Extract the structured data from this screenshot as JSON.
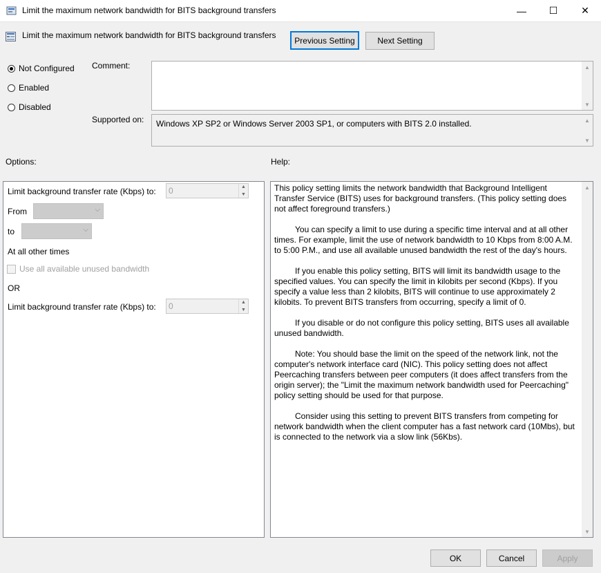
{
  "window": {
    "title": "Limit the maximum network bandwidth for BITS background transfers",
    "controls": {
      "minimize": "—",
      "maximize": "☐",
      "close": "✕"
    }
  },
  "header": {
    "title": "Limit the maximum network bandwidth for BITS background transfers",
    "previous_label": "Previous Setting",
    "next_label": "Next Setting"
  },
  "state": {
    "options": [
      {
        "label": "Not Configured",
        "selected": true
      },
      {
        "label": "Enabled",
        "selected": false
      },
      {
        "label": "Disabled",
        "selected": false
      }
    ]
  },
  "comment": {
    "label": "Comment:",
    "value": ""
  },
  "supported": {
    "label": "Supported on:",
    "value": "Windows XP SP2 or Windows Server 2003 SP1, or computers with BITS 2.0 installed."
  },
  "options_panel": {
    "heading": "Options:",
    "rate_label_1": "Limit background transfer rate (Kbps) to:",
    "rate_value_1": "0",
    "from_label": "From",
    "to_label": "to",
    "other_times_label": "At all other times",
    "use_all_label": "Use all available unused bandwidth",
    "or_label": "OR",
    "rate_label_2": "Limit background transfer rate (Kbps) to:",
    "rate_value_2": "0"
  },
  "help_panel": {
    "heading": "Help:",
    "paragraphs": [
      "This policy setting limits the network bandwidth that Background Intelligent Transfer Service (BITS) uses for background transfers. (This policy setting does not affect foreground transfers.)",
      "You can specify a limit to use during a specific time interval and at all other times. For example, limit the use of network bandwidth to 10 Kbps from 8:00 A.M. to 5:00 P.M., and use all available unused bandwidth the rest of the day's hours.",
      "If you enable this policy setting, BITS will limit its bandwidth usage to the specified values. You can specify the limit in kilobits per second (Kbps). If you specify a value less than 2 kilobits, BITS will continue to use approximately 2 kilobits. To prevent BITS transfers from occurring, specify a limit of 0.",
      "If you disable or do not configure this policy setting, BITS uses all available unused bandwidth.",
      "Note: You should base the limit on the speed of the network link, not the computer's network interface card (NIC). This policy setting does not affect Peercaching transfers between peer computers (it does affect transfers from the origin server); the \"Limit the maximum network bandwidth used for Peercaching\" policy setting should be used for that purpose.",
      "Consider using this setting to prevent BITS transfers from competing for network bandwidth when the client computer has a fast network card (10Mbs), but is connected to the network via a slow link (56Kbs)."
    ]
  },
  "footer": {
    "ok": "OK",
    "cancel": "Cancel",
    "apply": "Apply"
  }
}
